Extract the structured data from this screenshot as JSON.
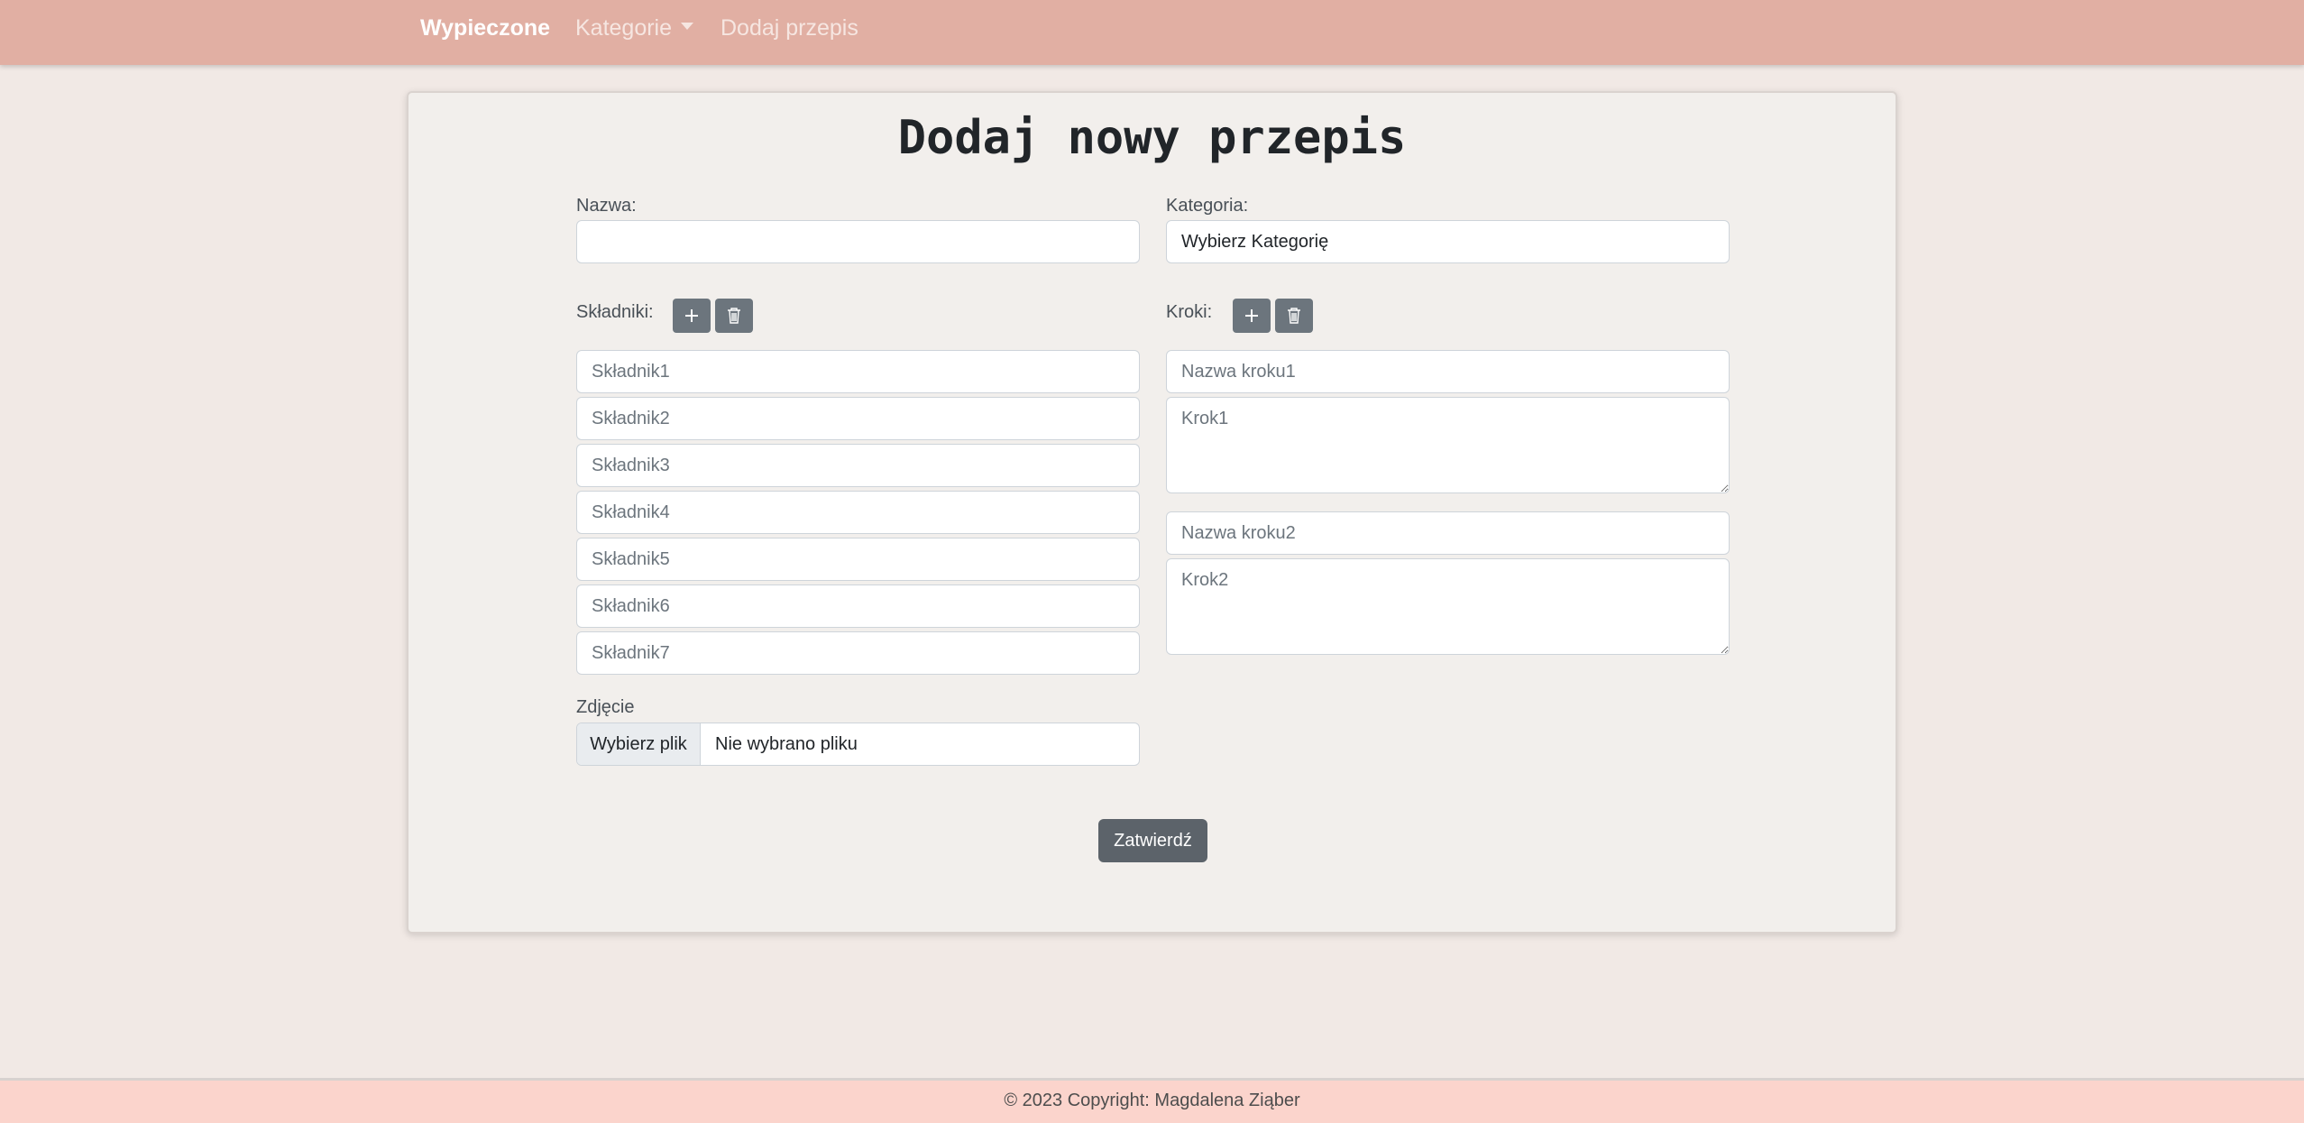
{
  "navbar": {
    "brand": "Wypieczone",
    "categories_label": "Kategorie",
    "add_recipe_label": "Dodaj przepis"
  },
  "form": {
    "title": "Dodaj nowy przepis",
    "name_label": "Nazwa:",
    "name_value": "",
    "category_label": "Kategoria:",
    "category_selected": "Wybierz Kategorię",
    "ingredients_label": "Składniki:",
    "ingredients_placeholders": [
      "Składnik1",
      "Składnik2",
      "Składnik3",
      "Składnik4",
      "Składnik5",
      "Składnik6",
      "Składnik7"
    ],
    "steps_label": "Kroki:",
    "steps": [
      {
        "name_placeholder": "Nazwa kroku1",
        "text_placeholder": "Krok1"
      },
      {
        "name_placeholder": "Nazwa kroku2",
        "text_placeholder": "Krok2"
      }
    ],
    "photo_label": "Zdjęcie",
    "file_button_label": "Wybierz plik",
    "file_status": "Nie wybrano pliku",
    "submit_label": "Zatwierdź"
  },
  "footer": {
    "text": "© 2023 Copyright: Magdalena Ziąber"
  },
  "icons": {
    "add": "plus-icon",
    "delete": "trash-icon"
  },
  "colors": {
    "navbar_bg": "#e1afa3",
    "page_bg": "#f1e9e5",
    "card_bg": "#f2efec",
    "button_gray": "#6c757d",
    "footer_bg": "#fbd4cc"
  }
}
